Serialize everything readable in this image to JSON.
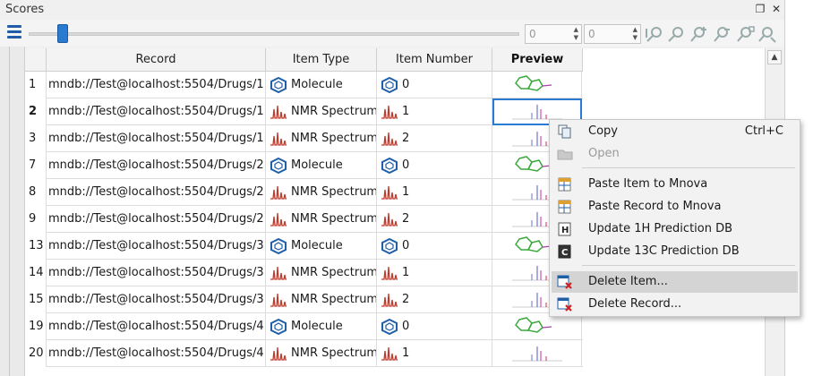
{
  "window": {
    "title": "Scores"
  },
  "toolbar": {
    "spin_from": "0",
    "spin_to": "0",
    "slider_position": 0.06
  },
  "table": {
    "columns": [
      "Record",
      "Item Type",
      "Item Number",
      "Preview"
    ],
    "rows": [
      {
        "num": "1",
        "record": "mndb://Test@localhost:5504/Drugs/1",
        "type": "Molecule",
        "item": "0"
      },
      {
        "num": "2",
        "record": "mndb://Test@localhost:5504/Drugs/1",
        "type": "NMR Spectrum",
        "item": "1"
      },
      {
        "num": "3",
        "record": "mndb://Test@localhost:5504/Drugs/1",
        "type": "NMR Spectrum",
        "item": "2"
      },
      {
        "num": "7",
        "record": "mndb://Test@localhost:5504/Drugs/2",
        "type": "Molecule",
        "item": "0"
      },
      {
        "num": "8",
        "record": "mndb://Test@localhost:5504/Drugs/2",
        "type": "NMR Spectrum",
        "item": "1"
      },
      {
        "num": "9",
        "record": "mndb://Test@localhost:5504/Drugs/2",
        "type": "NMR Spectrum",
        "item": "2"
      },
      {
        "num": "13",
        "record": "mndb://Test@localhost:5504/Drugs/3",
        "type": "Molecule",
        "item": "0"
      },
      {
        "num": "14",
        "record": "mndb://Test@localhost:5504/Drugs/3",
        "type": "NMR Spectrum",
        "item": "1"
      },
      {
        "num": "15",
        "record": "mndb://Test@localhost:5504/Drugs/3",
        "type": "NMR Spectrum",
        "item": "2"
      },
      {
        "num": "19",
        "record": "mndb://Test@localhost:5504/Drugs/4",
        "type": "Molecule",
        "item": "0"
      },
      {
        "num": "20",
        "record": "mndb://Test@localhost:5504/Drugs/4",
        "type": "NMR Spectrum",
        "item": "1"
      }
    ]
  },
  "context_menu": {
    "copy": "Copy",
    "copy_shortcut": "Ctrl+C",
    "open": "Open",
    "paste_item": "Paste Item to Mnova",
    "paste_record": "Paste Record to Mnova",
    "update_1h": "Update 1H Prediction DB",
    "update_13c": "Update 13C Prediction DB",
    "delete_item": "Delete Item...",
    "delete_record": "Delete Record..."
  },
  "colors": {
    "accent": "#2a7ad2",
    "molecule_icon": "#1f5fa8",
    "nmr_icon": "#c0392b",
    "menu_highlight": "#d4d4d4"
  }
}
